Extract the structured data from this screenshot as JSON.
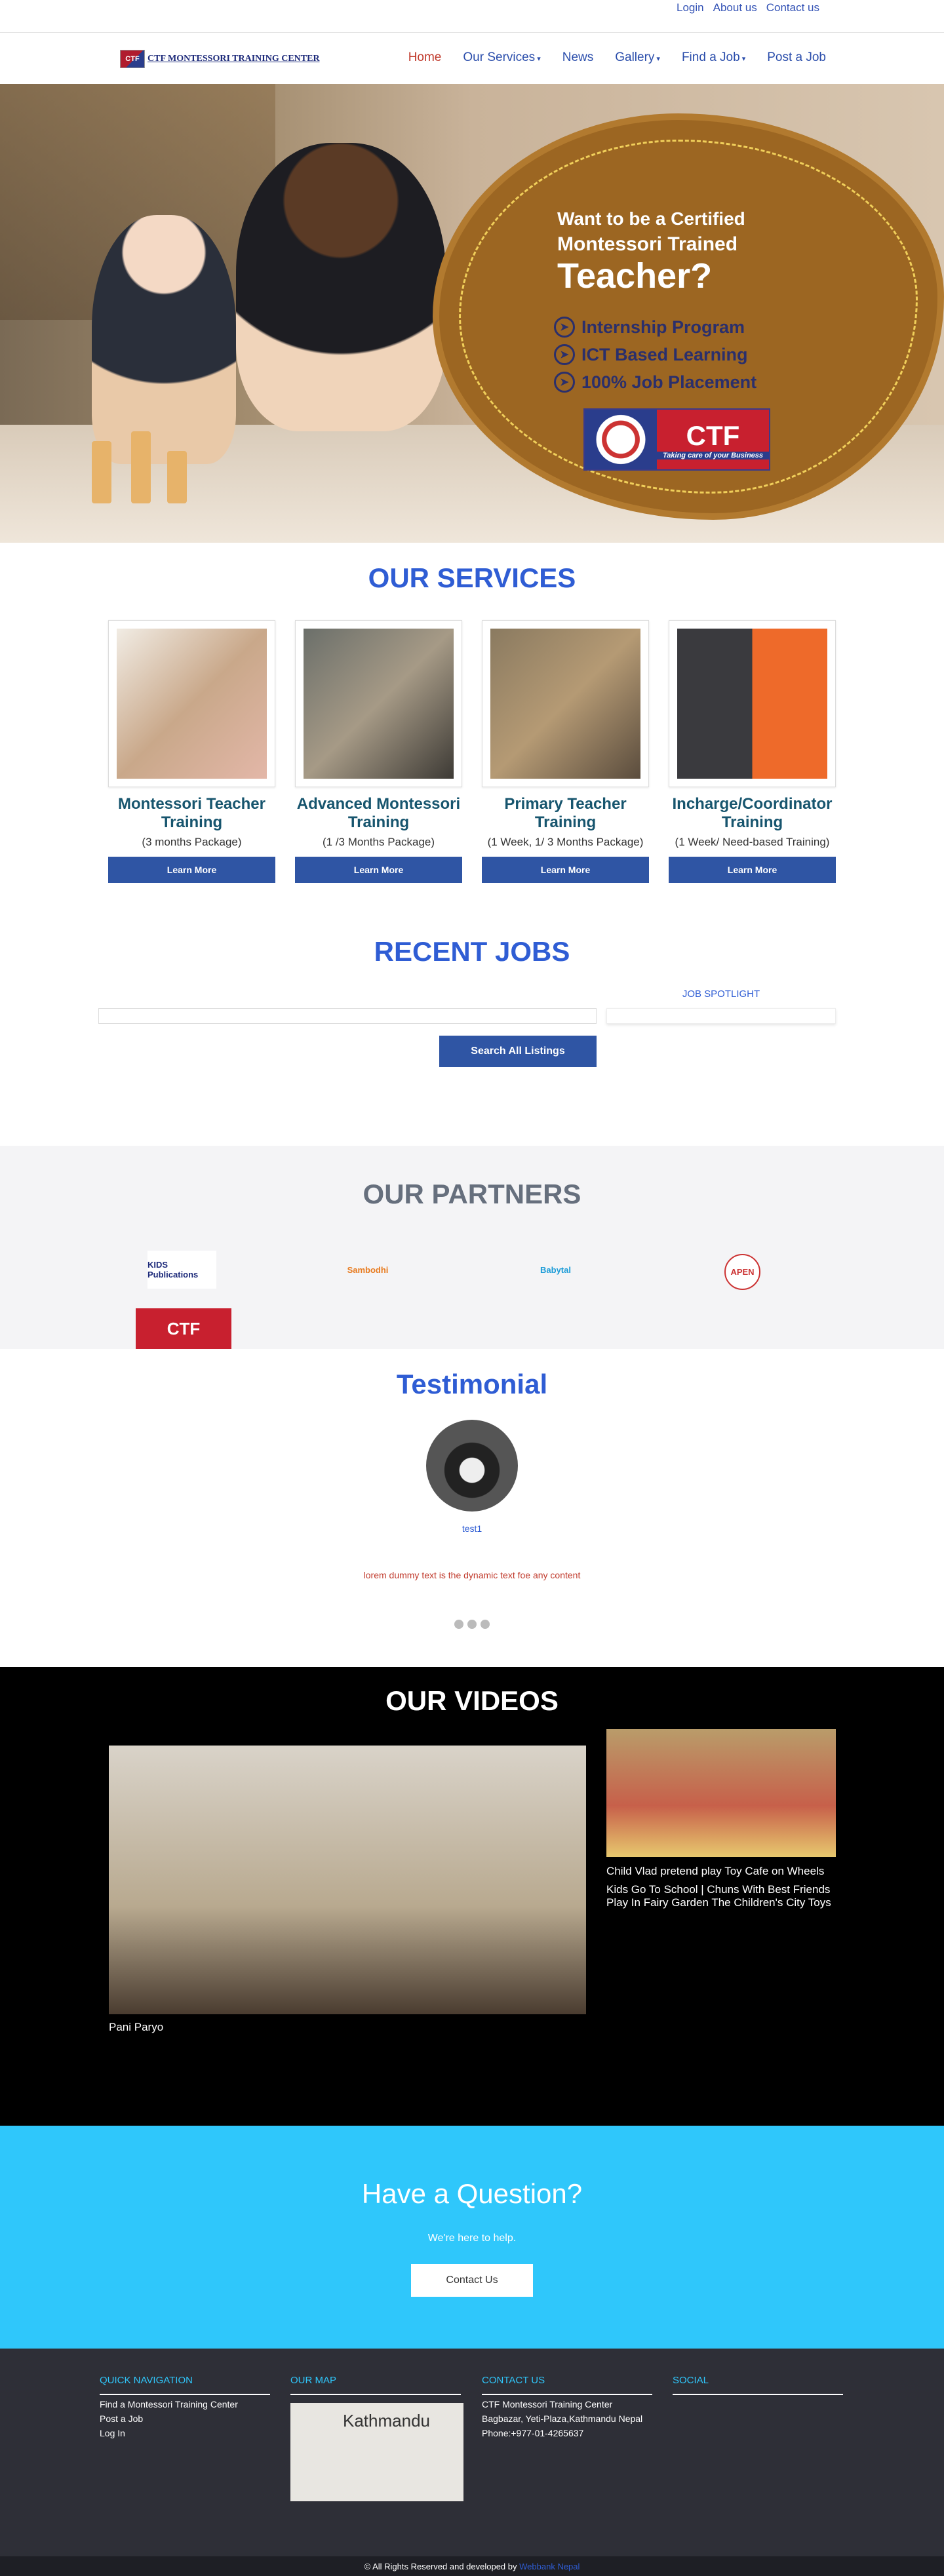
{
  "top": {
    "links": [
      "Login",
      "About us",
      "Contact us"
    ]
  },
  "nav": {
    "logo_text": "CTF MONTESSORI TRAINING CENTER",
    "logo_mark": "CTF",
    "items": [
      {
        "label": "Home"
      },
      {
        "label": "Our Services",
        "caret": "▾"
      },
      {
        "label": "News"
      },
      {
        "label": "Gallery",
        "caret": "▾"
      },
      {
        "label": "Find a Job",
        "caret": "▾"
      },
      {
        "label": "Post a Job"
      }
    ]
  },
  "hero": {
    "line1": "Want to be a Certified",
    "line2": "Montessori Trained",
    "line3": "Teacher?",
    "bullets": [
      "Internship Program",
      "ICT Based Learning",
      "100% Job Placement"
    ],
    "logo_text": "CTF",
    "logo_tagline": "Taking care of your Business"
  },
  "services": {
    "title": "OUR SERVICES",
    "items": [
      {
        "title": "Montessori Teacher Training",
        "desc": "(3 months Package)",
        "button": "Learn More"
      },
      {
        "title": "Advanced Montessori Training",
        "desc": "(1 /3 Months Package)",
        "button": "Learn More"
      },
      {
        "title": "Primary Teacher Training",
        "desc": "(1 Week, 1/ 3 Months Package)",
        "button": "Learn More"
      },
      {
        "title": "Incharge/Coordinator Training",
        "desc": "(1 Week/ Need-based Training)",
        "button": "Learn More"
      }
    ]
  },
  "jobs": {
    "title": "RECENT JOBS",
    "spotlight": "JOB SPOTLIGHT",
    "search_button": "Search All Listings"
  },
  "partners": {
    "title": "OUR PARTNERS",
    "logos": [
      "KIDS Publications",
      "Sambodhi",
      "Babytal",
      "APEN",
      "CTF"
    ]
  },
  "testimonial": {
    "title": "Testimonial",
    "name": "test1",
    "text": "lorem dummy text is the dynamic text foe any content"
  },
  "videos": {
    "title": "OUR VIDEOS",
    "main_caption": "Pani Paryo",
    "side_captions": [
      "Child Vlad pretend play Toy Cafe on Wheels",
      "Kids Go To School | Chuns With Best Friends Play In Fairy Garden The Children's City Toys"
    ]
  },
  "question": {
    "title": "Have a Question?",
    "subtitle": "We're here to help.",
    "button": "Contact Us"
  },
  "footer": {
    "quick_title": "QUICK NAVIGATION",
    "quick_links": [
      "Find a Montessori Training Center",
      "Post a Job",
      "Log In"
    ],
    "map_title": "OUR MAP",
    "map_label": "Kathmandu",
    "contact_title": "CONTACT US",
    "contact_lines": [
      "CTF Montessori Training Center",
      "Bagbazar, Yeti-Plaza,Kathmandu Nepal",
      "Phone:+977-01-4265637"
    ],
    "social_title": "SOCIAL",
    "copyright_prefix": "©",
    "copyright_mid": "All Rights Reserved and developed by",
    "developer": "Webbank Nepal"
  }
}
